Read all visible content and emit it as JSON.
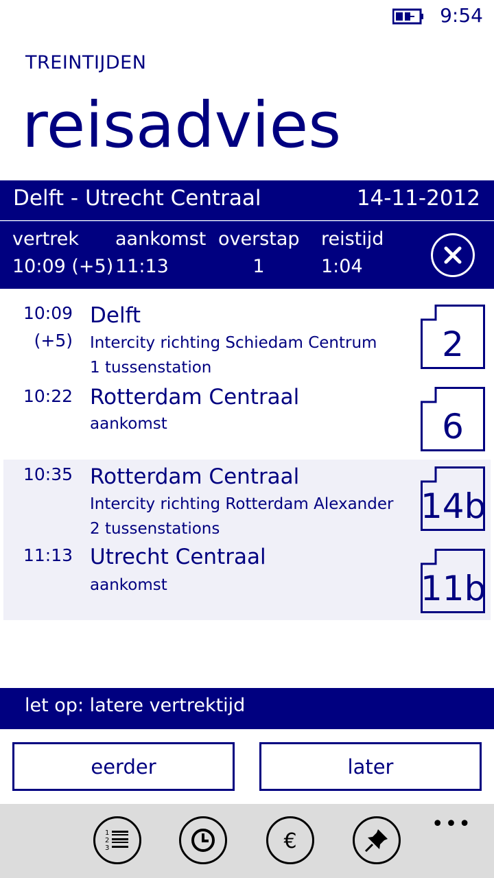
{
  "status": {
    "time": "9:54"
  },
  "header": {
    "app_title": "TREINTIJDEN",
    "page_title": "reisadvies"
  },
  "route": {
    "name": "Delft - Utrecht Centraal",
    "date": "14-11-2012"
  },
  "summary": {
    "headers": [
      "vertrek",
      "aankomst",
      "overstap",
      "reistijd"
    ],
    "values": [
      "10:09 (+5)",
      "11:13",
      "1",
      "1:04"
    ]
  },
  "legs": [
    {
      "time": "10:09",
      "delay": "(+5)",
      "station": "Delft",
      "line": "Intercity richting Schiedam Centrum",
      "stops": "1 tussenstation",
      "platform": "2"
    },
    {
      "time": "10:22",
      "station": "Rotterdam Centraal",
      "line": "aankomst",
      "platform": "6"
    },
    {
      "time": "10:35",
      "station": "Rotterdam Centraal",
      "line": "Intercity richting Rotterdam Alexander",
      "stops": "2 tussenstations",
      "platform": "14b"
    },
    {
      "time": "11:13",
      "station": "Utrecht Centraal",
      "line": "aankomst",
      "platform": "11b"
    }
  ],
  "notice": "let op: latere vertrektijd",
  "buttons": {
    "earlier": "eerder",
    "later": "later"
  },
  "appbar": {
    "icons": [
      "list-icon",
      "clock-icon",
      "euro-icon",
      "pin-icon"
    ],
    "more": "•••"
  },
  "colors": {
    "accent": "#000080",
    "shaded_row": "#f0f0f8",
    "appbar": "#dcdcdc"
  }
}
